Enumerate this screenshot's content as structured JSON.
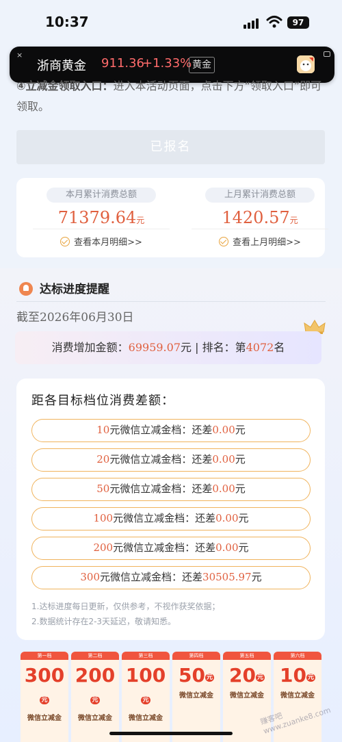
{
  "status_bar": {
    "time": "10:37",
    "battery": "97"
  },
  "ticker": {
    "close": "×",
    "name": "浙商黄金",
    "price": "911.36",
    "change": "+1.33%",
    "tag": "黄金"
  },
  "rules": {
    "partial_prefix": "④立减金领取入口：",
    "partial_text": "进入本活动页面，点击下方“领取入口”即可领取。"
  },
  "register_button": {
    "label": "已报名"
  },
  "spend": {
    "this_month": {
      "label": "本月累计消费总额",
      "value": "71379.64",
      "unit": "元",
      "link": "查看本月明细>>"
    },
    "last_month": {
      "label": "上月累计消费总额",
      "value": "1420.57",
      "unit": "元",
      "link": "查看上月明细>>"
    }
  },
  "progress": {
    "title": "达标进度提醒",
    "deadline": "截至2026年06月30日",
    "increase_label": "消费增加金额：",
    "increase_value": "69959.07",
    "increase_unit": "元",
    "separator": " | ",
    "rank_label": "排名：",
    "rank_prefix": "第",
    "rank_value": "4072",
    "rank_suffix": "名"
  },
  "gap": {
    "title": "距各目标档位消费差额：",
    "rows": [
      {
        "amount": "10",
        "label": "元微信立减金档：还差",
        "diff": "0.00",
        "unit": "元"
      },
      {
        "amount": "20",
        "label": "元微信立减金档：还差",
        "diff": "0.00",
        "unit": "元"
      },
      {
        "amount": "50",
        "label": "元微信立减金档：还差",
        "diff": "0.00",
        "unit": "元"
      },
      {
        "amount": "100",
        "label": "元微信立减金档：还差",
        "diff": "0.00",
        "unit": "元"
      },
      {
        "amount": "200",
        "label": "元微信立减金档：还差",
        "diff": "0.00",
        "unit": "元"
      },
      {
        "amount": "300",
        "label": "元微信立减金档：还差",
        "diff": "30505.97",
        "unit": "元"
      }
    ],
    "note_1": "1.达标进度每日更新，仅供参考，不视作获奖依据；",
    "note_2": "2.数据统计存在2-3天延迟，敬请知悉。"
  },
  "tiers": [
    {
      "head": "第一档",
      "amount": "300",
      "yuan": "元",
      "label": "微信立减金"
    },
    {
      "head": "第二档",
      "amount": "200",
      "yuan": "元",
      "label": "微信立减金"
    },
    {
      "head": "第三档",
      "amount": "100",
      "yuan": "元",
      "label": "微信立减金"
    },
    {
      "head": "第四档",
      "amount": "50",
      "yuan": "元",
      "label": "微信立减金"
    },
    {
      "head": "第五档",
      "amount": "20",
      "yuan": "元",
      "label": "微信立减金"
    },
    {
      "head": "第六档",
      "amount": "10",
      "yuan": "元",
      "label": "微信立减金"
    }
  ],
  "watermark": "赚客吧 www.zuanke8.com",
  "colors": {
    "accent": "#e0603f",
    "gold": "#f0b35c",
    "ticker_up": "#ff6b6b"
  }
}
